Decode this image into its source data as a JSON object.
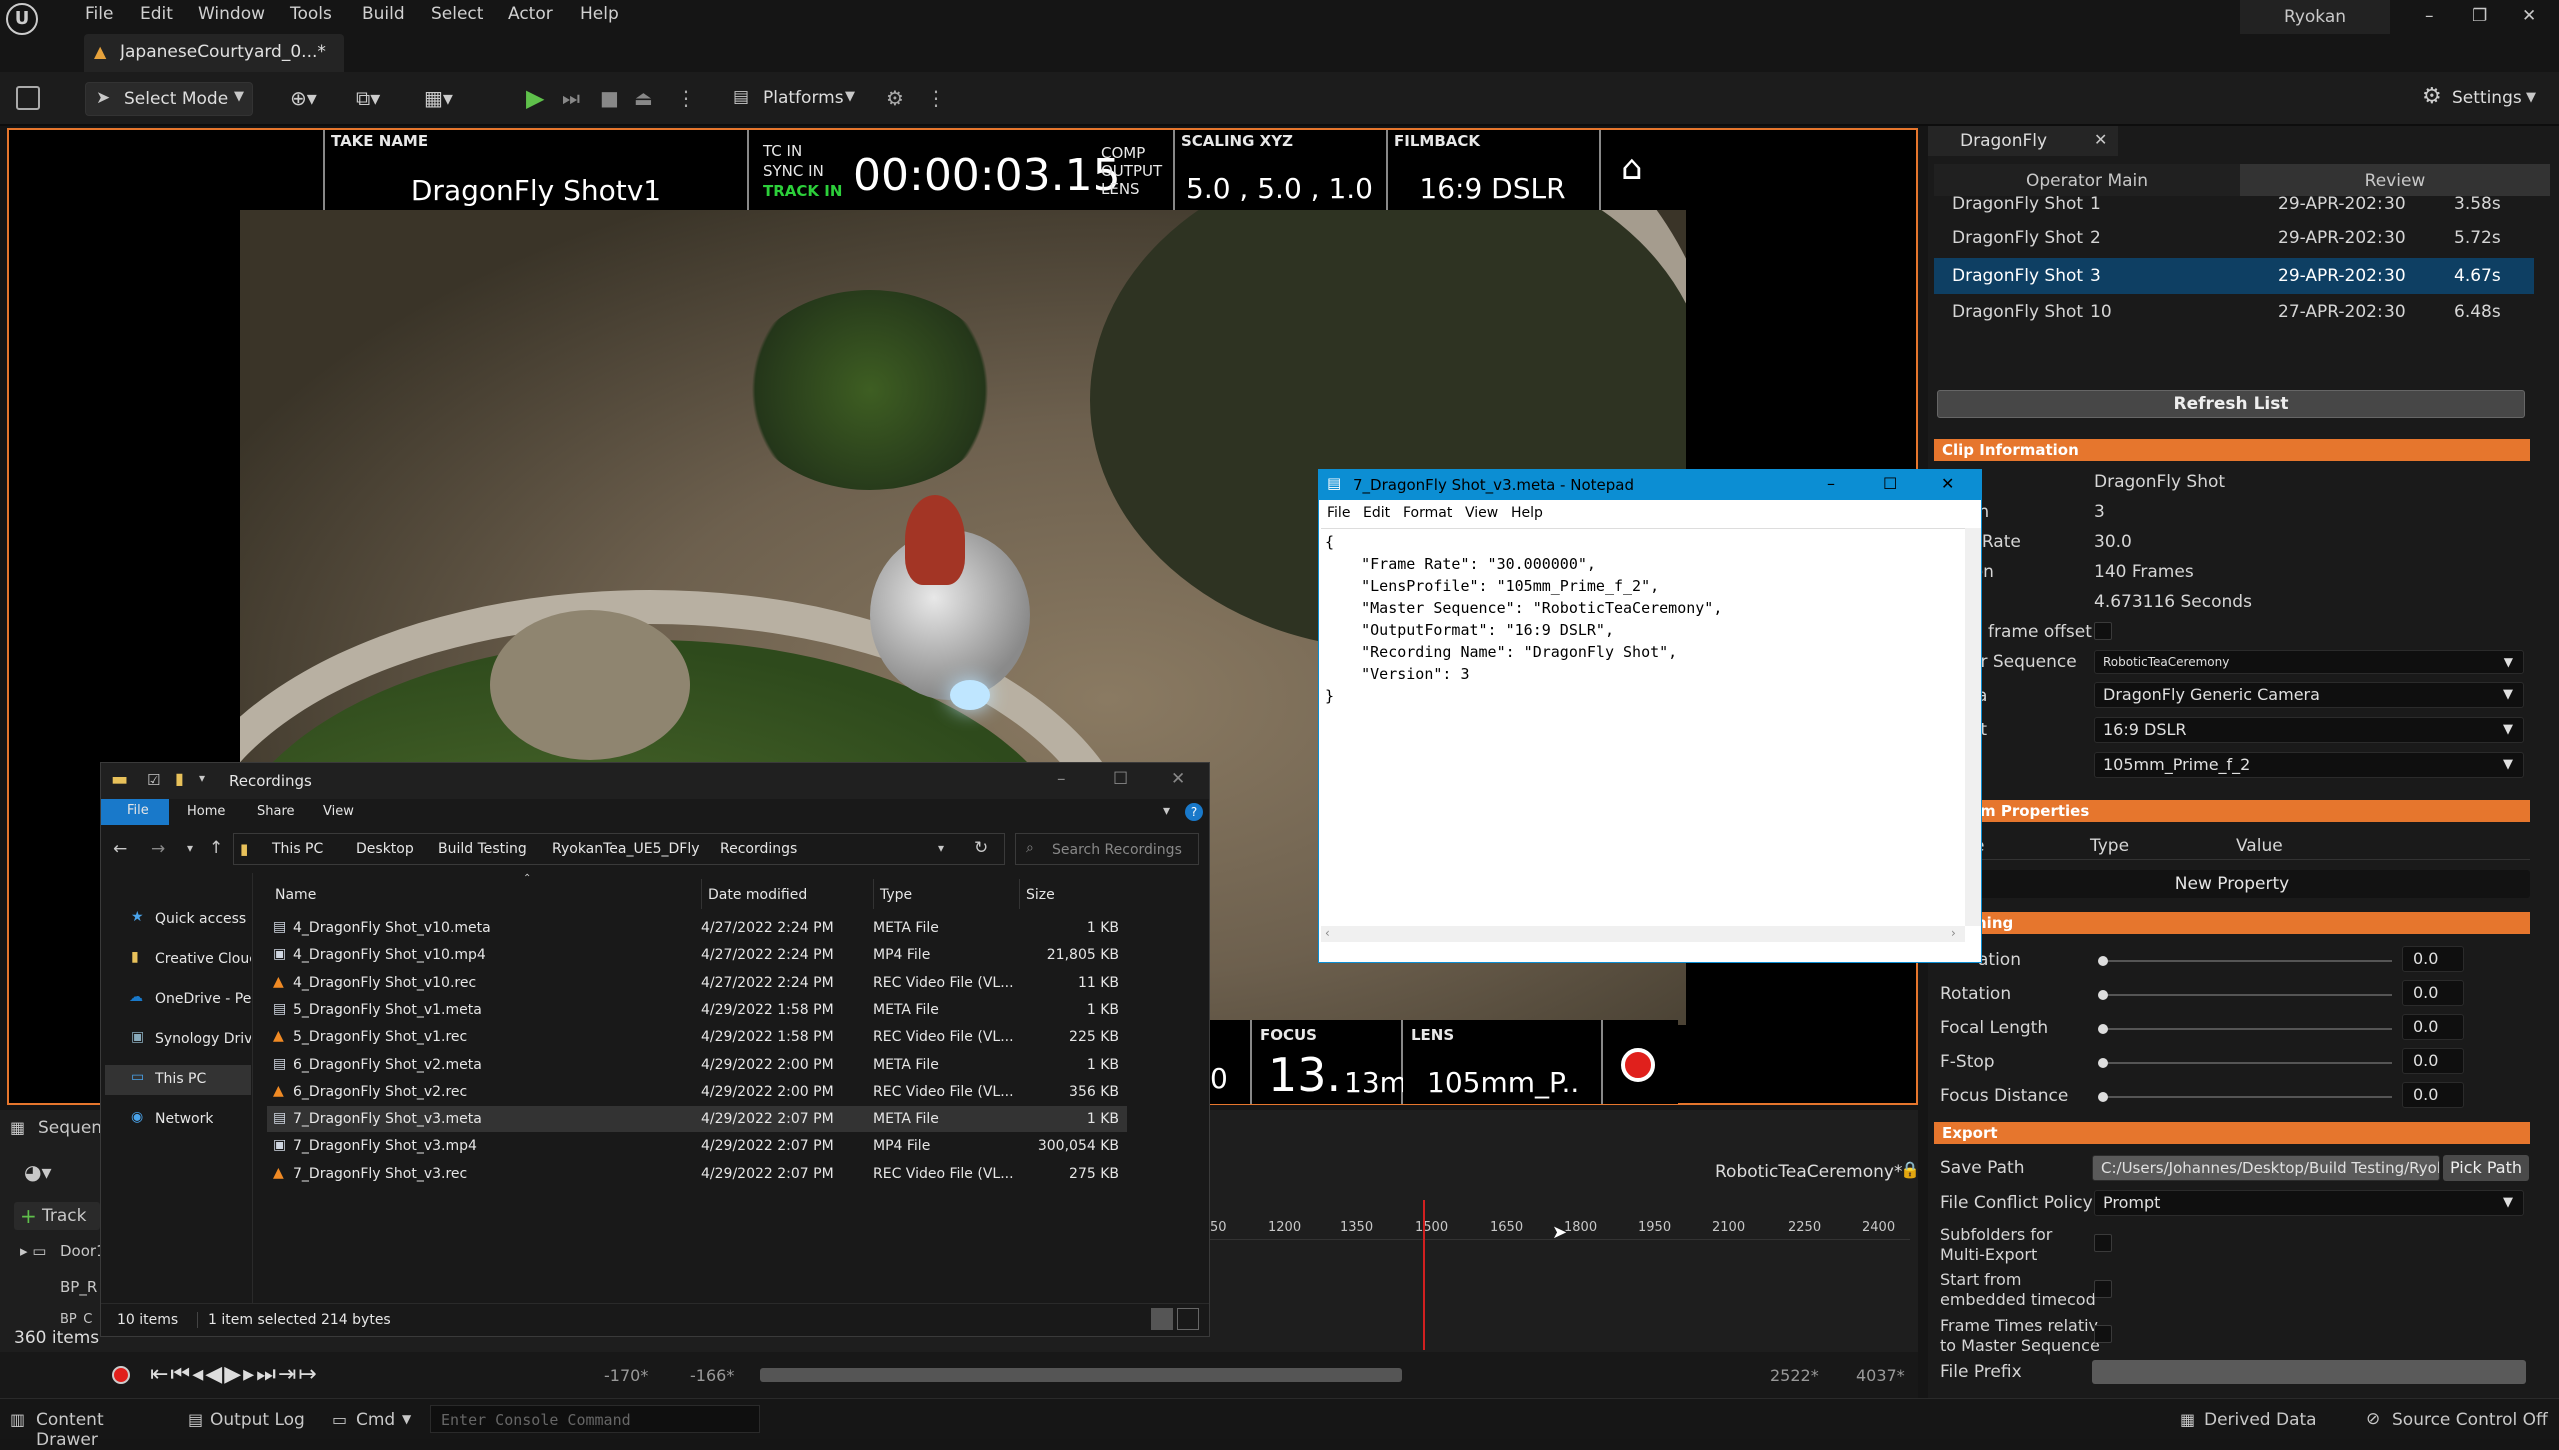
{
  "app": {
    "title_user": "Ryokan",
    "menu": [
      "File",
      "Edit",
      "Window",
      "Tools",
      "Build",
      "Select",
      "Actor",
      "Help"
    ],
    "doc_tab": "JapaneseCourtyard_0...*",
    "window_controls": [
      "–",
      "❐",
      "✕"
    ]
  },
  "toolbar": {
    "select_mode": "Select Mode",
    "platforms": "Platforms",
    "settings": "Settings"
  },
  "hud": {
    "take_name_caption": "TAKE NAME",
    "take_name": "DragonFly Shotv1",
    "tc_in": "TC IN",
    "sync_in": "SYNC IN",
    "track_in": "TRACK IN",
    "timecode": "00:00:03.15",
    "comp": "COMP",
    "output": "OUTPUT",
    "lens_caption_top": "LENS",
    "scaling_caption": "SCALING XYZ",
    "scaling": "5.0 , 5.0 , 1.0",
    "filmback_caption": "FILMBACK",
    "filmback": "16:9 DSLR",
    "bottom_partial": "0",
    "focus_caption": "FOCUS",
    "focus_big": "13.",
    "focus_small": "13m",
    "lens_caption": "LENS",
    "lens_value": "105mm_P.."
  },
  "panel": {
    "tab_title": "DragonFly",
    "subtabs": [
      "Operator Main",
      "Review"
    ],
    "takes": [
      {
        "name": "DragonFly Shot",
        "num": "1",
        "date": "29-APR-202:",
        "fps": "30",
        "dur": "3.58s"
      },
      {
        "name": "DragonFly Shot",
        "num": "2",
        "date": "29-APR-202:",
        "fps": "30",
        "dur": "5.72s"
      },
      {
        "name": "DragonFly Shot",
        "num": "3",
        "date": "29-APR-202:",
        "fps": "30",
        "dur": "4.67s"
      },
      {
        "name": "DragonFly Shot",
        "num": "10",
        "date": "27-APR-202:",
        "fps": "30",
        "dur": "6.48s"
      }
    ],
    "refresh": "Refresh List",
    "clip_info_header": "Clip Information",
    "clip": {
      "name_value": "DragonFly Shot",
      "version_label": "on",
      "version_value": "3",
      "rate_label": "e Rate",
      "rate_value": "30.0",
      "duration_label": "ion",
      "frames_value": "140 Frames",
      "seconds_value": "4.673116 Seconds",
      "offset_label": "frame offset",
      "seq_label": "er Sequence",
      "seq_value": "RoboticTeaCeremony",
      "camera_label": "ra",
      "camera_value": "DragonFly Generic Camera",
      "format_label": "at",
      "format_value": "16:9 DSLR",
      "lens_value": "105mm_Prime_f_2"
    },
    "custom_header": "m Properties",
    "custom_cols": [
      "e",
      "Type",
      "Value"
    ],
    "new_property": "New Property",
    "smoothing_header": "hing",
    "sliders": [
      {
        "label": "ation",
        "value": "0.0",
        "level": 0
      },
      {
        "label": "Rotation",
        "value": "0.0",
        "level": 0
      },
      {
        "label": "Focal Length",
        "value": "0.0",
        "level": 0
      },
      {
        "label": "F-Stop",
        "value": "0.0",
        "level": 0
      },
      {
        "label": "Focus Distance",
        "value": "0.0",
        "level": 0
      }
    ],
    "export_header": "Export",
    "save_path_label": "Save Path",
    "save_path_value": "C:/Users/Johannes/Desktop/Build Testing/Ryoka",
    "pick_path": "Pick Path",
    "conflict_label": "File Conflict Policy",
    "conflict_value": "Prompt",
    "subfolders_label": [
      "Subfolders for",
      "Multi-Export"
    ],
    "start_label": [
      "Start from",
      "embedded timecod"
    ],
    "frametimes_label": [
      "Frame Times relativ",
      "to Master Sequence"
    ],
    "prefix_label": "File Prefix"
  },
  "sequencer": {
    "tab": "Sequen",
    "track": "Track",
    "rows": [
      "Door1",
      "BP_R",
      "BP_C"
    ],
    "items": "360 items",
    "sequence_name": "RoboticTeaCeremony*",
    "ticks": [
      "50",
      "1200",
      "1350",
      "1500",
      "1650",
      "1800",
      "1950",
      "2100",
      "2250",
      "2400"
    ],
    "range_start": "-170*",
    "range_start2": "-166*",
    "range_end": "2522*",
    "range_end2": "4037*"
  },
  "explorer": {
    "title": "Recordings",
    "ribbon": [
      "File",
      "Home",
      "Share",
      "View"
    ],
    "breadcrumb": [
      "This PC",
      "Desktop",
      "Build Testing",
      "RyokanTea_UE5_DFly",
      "Recordings"
    ],
    "search_placeholder": "Search Recordings",
    "nav": [
      "Quick access",
      "Creative Clouc",
      "OneDrive - Per",
      "Synology Driv",
      "This PC",
      "Network"
    ],
    "columns": [
      "Name",
      "Date modified",
      "Type",
      "Size"
    ],
    "files": [
      {
        "name": "4_DragonFly Shot_v10.meta",
        "date": "4/27/2022 2:24 PM",
        "type": "META File",
        "size": "1 KB",
        "kind": "doc"
      },
      {
        "name": "4_DragonFly Shot_v10.mp4",
        "date": "4/27/2022 2:24 PM",
        "type": "MP4 File",
        "size": "21,805 KB",
        "kind": "vid"
      },
      {
        "name": "4_DragonFly Shot_v10.rec",
        "date": "4/27/2022 2:24 PM",
        "type": "REC Video File (VL...",
        "size": "11 KB",
        "kind": "vlc"
      },
      {
        "name": "5_DragonFly Shot_v1.meta",
        "date": "4/29/2022 1:58 PM",
        "type": "META File",
        "size": "1 KB",
        "kind": "doc"
      },
      {
        "name": "5_DragonFly Shot_v1.rec",
        "date": "4/29/2022 1:58 PM",
        "type": "REC Video File (VL...",
        "size": "225 KB",
        "kind": "vlc"
      },
      {
        "name": "6_DragonFly Shot_v2.meta",
        "date": "4/29/2022 2:00 PM",
        "type": "META File",
        "size": "1 KB",
        "kind": "doc"
      },
      {
        "name": "6_DragonFly Shot_v2.rec",
        "date": "4/29/2022 2:00 PM",
        "type": "REC Video File (VL...",
        "size": "356 KB",
        "kind": "vlc"
      },
      {
        "name": "7_DragonFly Shot_v3.meta",
        "date": "4/29/2022 2:07 PM",
        "type": "META File",
        "size": "1 KB",
        "kind": "doc"
      },
      {
        "name": "7_DragonFly Shot_v3.mp4",
        "date": "4/29/2022 2:07 PM",
        "type": "MP4 File",
        "size": "300,054 KB",
        "kind": "vid"
      },
      {
        "name": "7_DragonFly Shot_v3.rec",
        "date": "4/29/2022 2:07 PM",
        "type": "REC Video File (VL...",
        "size": "275 KB",
        "kind": "vlc"
      }
    ],
    "status": "10 items",
    "status2": "1 item selected  214 bytes"
  },
  "notepad": {
    "title": "7_DragonFly Shot_v3.meta - Notepad",
    "menu": [
      "File",
      "Edit",
      "Format",
      "View",
      "Help"
    ],
    "lines": [
      "{",
      "    \"Frame Rate\": \"30.000000\",",
      "    \"LensProfile\": \"105mm_Prime_f_2\",",
      "    \"Master Sequence\": \"RoboticTeaCeremony\",",
      "    \"OutputFormat\": \"16:9 DSLR\",",
      "    \"Recording Name\": \"DragonFly Shot\",",
      "    \"Version\": 3",
      "}"
    ]
  },
  "statusbar": {
    "content_drawer": "Content Drawer",
    "output_log": "Output Log",
    "cmd": "Cmd",
    "console_placeholder": "Enter Console Command",
    "derived": "Derived Data",
    "source_control": "Source Control Off"
  },
  "colors": {
    "accent": "#e6762d",
    "selection": "#0e3f63",
    "win_blue": "#0c8ed3"
  }
}
